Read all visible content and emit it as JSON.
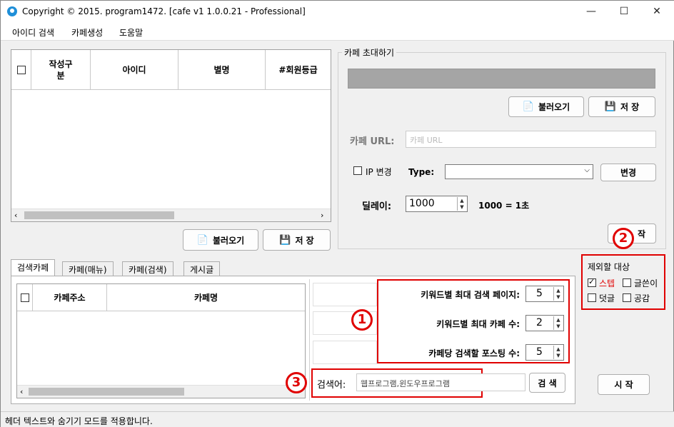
{
  "window": {
    "title": "Copyright © 2015. program1472. [cafe v1 1.0.0.21 - Professional]",
    "minimize": "—",
    "maximize": "☐",
    "close": "✕"
  },
  "menu": [
    "아이디 검색",
    "카페생성",
    "도움말"
  ],
  "top_grid": {
    "columns": [
      "작성구\n분",
      "아이디",
      "별명",
      "#회원등급"
    ]
  },
  "top_buttons": {
    "load": "불러오기",
    "save": "저 장"
  },
  "invite": {
    "group_title": "카페 초대하기",
    "load": "불러오기",
    "save": "저 장",
    "url_label": "카페 URL:",
    "url_placeholder": "카페 URL",
    "ip_change_label": "IP 변경",
    "type_label": "Type:",
    "change_button": "변경",
    "delay_label": "딜레이:",
    "delay_value": "1000",
    "delay_note": "1000 = 1초",
    "start_button": "작"
  },
  "exclude": {
    "title": "제외할 대상",
    "options": [
      {
        "label": "스텝",
        "checked": true,
        "color": "#e00000"
      },
      {
        "label": "글쓴이",
        "checked": false
      },
      {
        "label": "덧글",
        "checked": false
      },
      {
        "label": "공감",
        "checked": false
      }
    ]
  },
  "tabs": [
    "검색카페",
    "카페(매뉴)",
    "카페(검색)",
    "게시글"
  ],
  "bottom_grid": {
    "columns": [
      "카페주소",
      "카페명"
    ]
  },
  "settings": {
    "max_pages_label": "키워드별 최대 검색 페이지:",
    "max_pages": "5",
    "max_cafes_label": "키워드별 최대 카페 수:",
    "max_cafes": "2",
    "posts_label": "카페당 검색할 포스팅 수:",
    "posts": "5"
  },
  "search": {
    "label": "검색어:",
    "value": "웹프로그램,윈도우프로그램",
    "button": "검 색"
  },
  "start_button": "시 작",
  "annotations": [
    "1",
    "2",
    "3"
  ],
  "status_text": "헤더 텍스트와 숨기기 모드를 적용합니다."
}
